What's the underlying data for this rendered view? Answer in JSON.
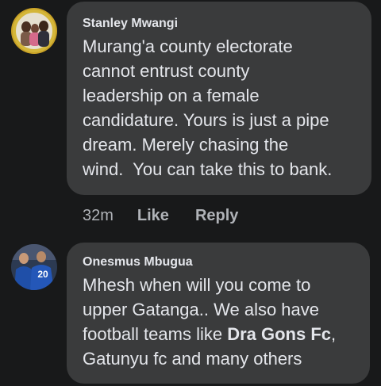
{
  "comments": [
    {
      "author": "Stanley Mwangi",
      "text": "Murang'a county electorate cannot entrust county leadership on a female candidature. Yours is just a pipe dream. Merely chasing the wind.  You can take this to bank.",
      "lines": [
        "Murang'a county electorate",
        "cannot entrust county",
        "leadership on a female",
        "candidature. Yours is just a pipe",
        "dream. Merely chasing the",
        "wind.  You can take this to bank."
      ],
      "time": "32m",
      "like_label": "Like",
      "reply_label": "Reply"
    },
    {
      "author": "Onesmus Mbugua",
      "lines": [
        "Mhesh when will you come to",
        "upper Gatanga.. We also have",
        "football teams like ",
        "Dra Gons Fc",
        ",",
        "Gatunyu fc and many others"
      ],
      "avatar_jersey_number": "20"
    }
  ],
  "colors": {
    "background": "#18191a",
    "bubble": "#3a3b3c",
    "text": "#e4e6eb",
    "meta": "#b0b3b8"
  }
}
